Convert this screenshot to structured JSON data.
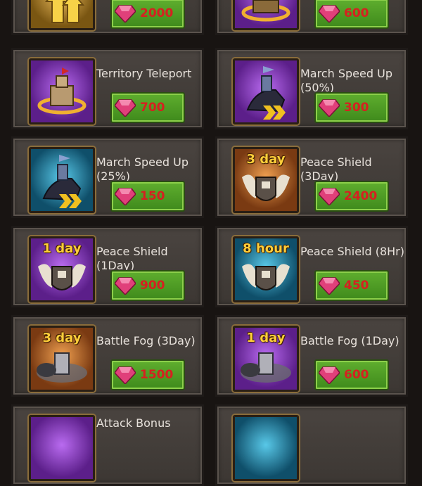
{
  "colors": {
    "price_text": "#d62020",
    "button_green": "#4f9e24",
    "card_bg": "#423d39"
  },
  "items": [
    {
      "name": "",
      "price": "2000",
      "badge": "",
      "icon": "upgrade-arrows-icon"
    },
    {
      "name": "",
      "price": "600",
      "badge": "",
      "icon": "relocate-chest-icon"
    },
    {
      "name": "Territory Teleport",
      "price": "700",
      "badge": "",
      "icon": "castle-teleport-icon"
    },
    {
      "name": "March Speed Up (50%)",
      "price": "300",
      "badge": "",
      "icon": "knight-march-icon"
    },
    {
      "name": "March Speed Up (25%)",
      "price": "150",
      "badge": "",
      "icon": "knight-march-icon"
    },
    {
      "name": "Peace Shield (3Day)",
      "price": "2400",
      "badge": "3 day",
      "icon": "shield-icon"
    },
    {
      "name": "Peace Shield (1Day)",
      "price": "900",
      "badge": "1 day",
      "icon": "shield-icon"
    },
    {
      "name": "Peace Shield (8Hr)",
      "price": "450",
      "badge": "8 hour",
      "icon": "shield-icon"
    },
    {
      "name": "Battle Fog (3Day)",
      "price": "1500",
      "badge": "3 day",
      "icon": "fog-knight-icon"
    },
    {
      "name": "Battle Fog (1Day)",
      "price": "600",
      "badge": "1 day",
      "icon": "fog-knight-icon"
    },
    {
      "name": "Attack Bonus",
      "price": "",
      "badge": "",
      "icon": "attack-icon"
    },
    {
      "name": "",
      "price": "",
      "badge": "",
      "icon": "blue-item-icon"
    }
  ]
}
